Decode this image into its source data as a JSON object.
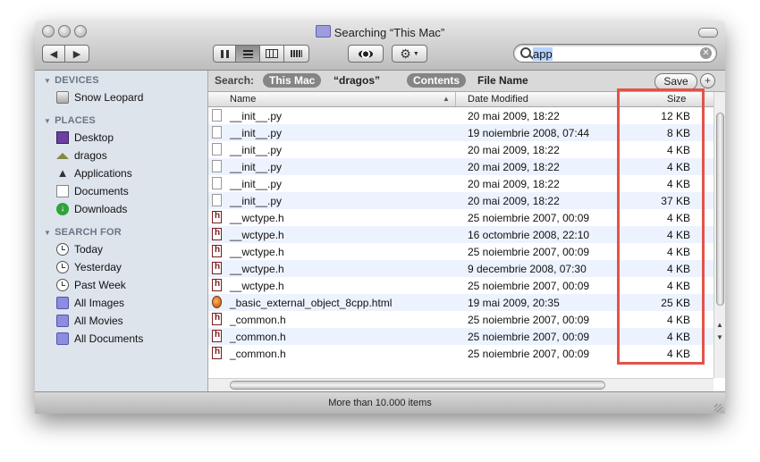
{
  "window": {
    "title": "Searching “This Mac”"
  },
  "toolbar": {
    "search": {
      "value": "app"
    },
    "icons": {
      "back": "back-arrow-icon",
      "forward": "forward-arrow-icon",
      "quicklook": "eye-icon",
      "action": "gear-icon"
    }
  },
  "sidebar": {
    "devices": {
      "header": "DEVICES",
      "items": [
        "Snow Leopard"
      ]
    },
    "places": {
      "header": "PLACES",
      "items": [
        "Desktop",
        "dragos",
        "Applications",
        "Documents",
        "Downloads"
      ]
    },
    "search_for": {
      "header": "SEARCH FOR",
      "items": [
        "Today",
        "Yesterday",
        "Past Week",
        "All Images",
        "All Movies",
        "All Documents"
      ]
    }
  },
  "scopebar": {
    "label": "Search:",
    "scope_this_mac": "This Mac",
    "scope_dragos": "“dragos”",
    "contents": "Contents",
    "file_name": "File Name",
    "save": "Save",
    "add": "+"
  },
  "columns": {
    "name": "Name",
    "date": "Date Modified",
    "size": "Size"
  },
  "files": [
    {
      "name": "__init__.py",
      "date": "20 mai 2009, 18:22",
      "size": "12 KB",
      "icon": "py"
    },
    {
      "name": "__init__.py",
      "date": "19 noiembrie 2008, 07:44",
      "size": "8 KB",
      "icon": "py"
    },
    {
      "name": "__init__.py",
      "date": "20 mai 2009, 18:22",
      "size": "4 KB",
      "icon": "py"
    },
    {
      "name": "__init__.py",
      "date": "20 mai 2009, 18:22",
      "size": "4 KB",
      "icon": "py"
    },
    {
      "name": "__init__.py",
      "date": "20 mai 2009, 18:22",
      "size": "4 KB",
      "icon": "py"
    },
    {
      "name": "__init__.py",
      "date": "20 mai 2009, 18:22",
      "size": "37 KB",
      "icon": "py"
    },
    {
      "name": "__wctype.h",
      "date": "25 noiembrie 2007, 00:09",
      "size": "4 KB",
      "icon": "h"
    },
    {
      "name": "__wctype.h",
      "date": "16 octombrie 2008, 22:10",
      "size": "4 KB",
      "icon": "h"
    },
    {
      "name": "__wctype.h",
      "date": "25 noiembrie 2007, 00:09",
      "size": "4 KB",
      "icon": "h"
    },
    {
      "name": "__wctype.h",
      "date": "9 decembrie 2008, 07:30",
      "size": "4 KB",
      "icon": "h"
    },
    {
      "name": "__wctype.h",
      "date": "25 noiembrie 2007, 00:09",
      "size": "4 KB",
      "icon": "h"
    },
    {
      "name": "_basic_external_object_8cpp.html",
      "date": "19 mai 2009, 20:35",
      "size": "25 KB",
      "icon": "web"
    },
    {
      "name": "_common.h",
      "date": "25 noiembrie 2007, 00:09",
      "size": "4 KB",
      "icon": "h"
    },
    {
      "name": "_common.h",
      "date": "25 noiembrie 2007, 00:09",
      "size": "4 KB",
      "icon": "h"
    },
    {
      "name": "_common.h",
      "date": "25 noiembrie 2007, 00:09",
      "size": "4 KB",
      "icon": "h"
    }
  ],
  "status": {
    "text": "More than 10.000 items"
  },
  "colors": {
    "annotation": "#e2534a",
    "sidebar_bg": "#dde4ec",
    "row_alt": "#edf3fe"
  }
}
